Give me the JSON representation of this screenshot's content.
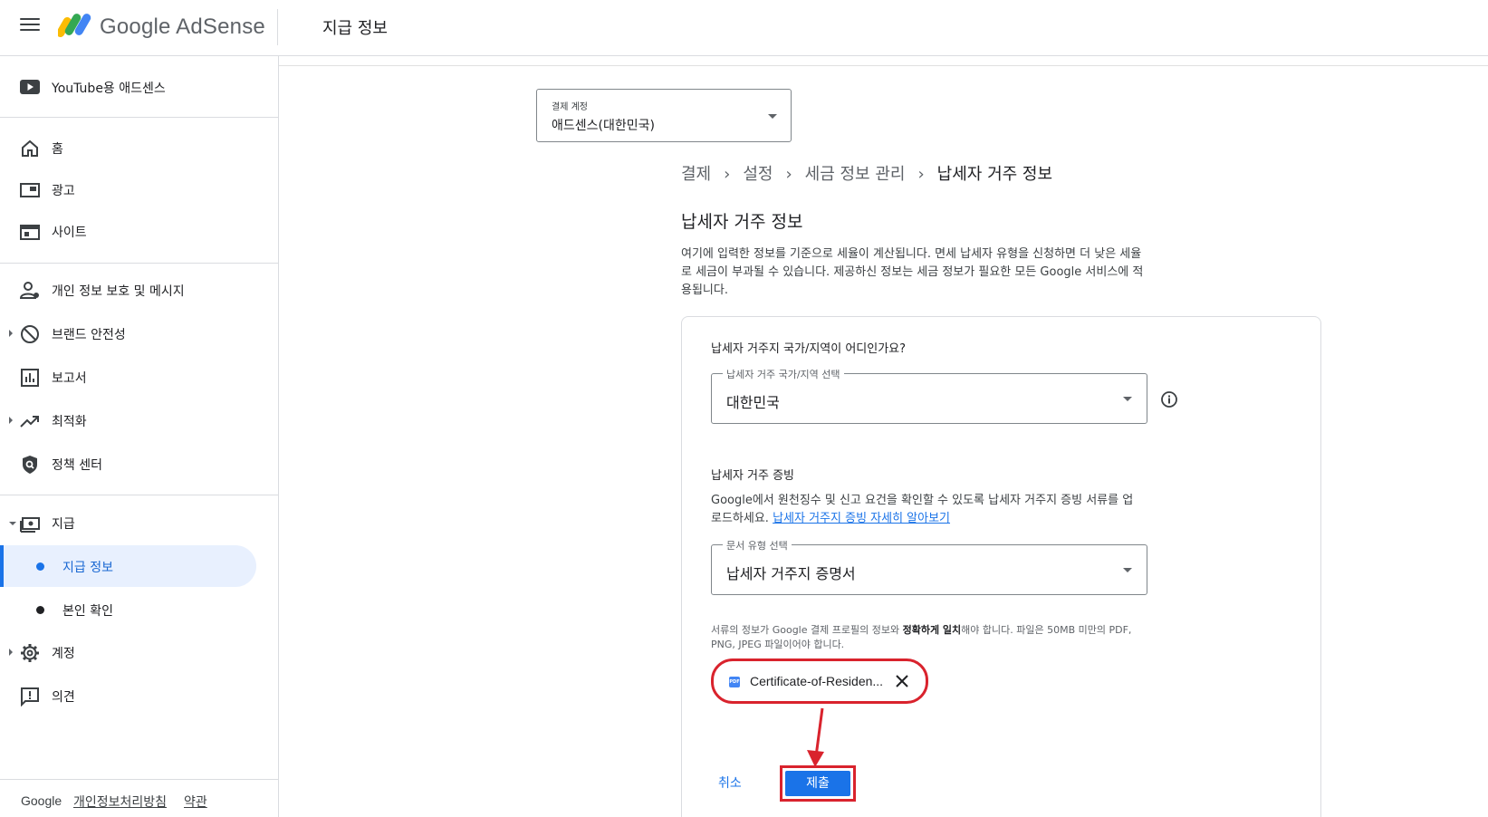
{
  "header": {
    "brand": "Google AdSense",
    "page_title": "지급 정보"
  },
  "sidebar": {
    "youtube": "YouTube용 애드센스",
    "items": [
      {
        "label": "홈",
        "icon": "home-icon"
      },
      {
        "label": "광고",
        "icon": "ads-icon"
      },
      {
        "label": "사이트",
        "icon": "sites-icon"
      },
      {
        "label": "개인 정보 보호 및 메시지",
        "icon": "privacy-messaging-icon"
      },
      {
        "label": "브랜드 안전성",
        "icon": "block-icon"
      },
      {
        "label": "보고서",
        "icon": "reports-icon"
      },
      {
        "label": "최적화",
        "icon": "trending-icon"
      },
      {
        "label": "정책 센터",
        "icon": "policy-shield-icon"
      },
      {
        "label": "지급",
        "icon": "payments-icon"
      },
      {
        "label": "계정",
        "icon": "gear-icon"
      },
      {
        "label": "의견",
        "icon": "feedback-icon"
      }
    ],
    "sub_items": [
      {
        "label": "지급 정보",
        "active": true
      },
      {
        "label": "본인 확인",
        "active": false
      }
    ],
    "footer": {
      "google": "Google",
      "privacy": "개인정보처리방침",
      "terms": "약관"
    }
  },
  "account_select": {
    "label": "결제 계정",
    "value": "애드센스(대한민국)"
  },
  "breadcrumb": [
    "결제",
    "설정",
    "세금 정보 관리",
    "납세자 거주 정보"
  ],
  "section": {
    "title": "납세자 거주 정보",
    "description": "여기에 입력한 정보를 기준으로 세율이 계산됩니다. 면세 납세자 유형을 신청하면 더 낮은 세율로 세금이 부과될 수 있습니다. 제공하신 정보는 세금 정보가 필요한 모든 Google 서비스에 적용됩니다."
  },
  "form": {
    "question": "납세자 거주지 국가/지역이 어디인가요?",
    "country_field": {
      "label": "납세자 거주 국가/지역 선택",
      "value": "대한민국"
    },
    "proof_heading": "납세자 거주 증빙",
    "proof_desc": "Google에서 원천징수 및 신고 요건을 확인할 수 있도록 납세자 거주지 증빙 서류를 업로드하세요.",
    "proof_link": "납세자 거주지 증빙 자세히 알아보기",
    "doc_type_field": {
      "label": "문서 유형 선택",
      "value": "납세자 거주지 증명서"
    },
    "note_prefix": "서류의 정보가 Google 결제 프로필의 정보와 ",
    "note_bold": "정확하게 일치",
    "note_suffix": "해야 합니다. 파일은 50MB 미만의 PDF, PNG, JPEG 파일이어야 합니다.",
    "file_name": "Certificate-of-Residen...",
    "file_badge": "PDF",
    "cancel": "취소",
    "submit": "제출"
  },
  "colors": {
    "accent": "#1a73e8",
    "highlight": "#d9232d"
  }
}
